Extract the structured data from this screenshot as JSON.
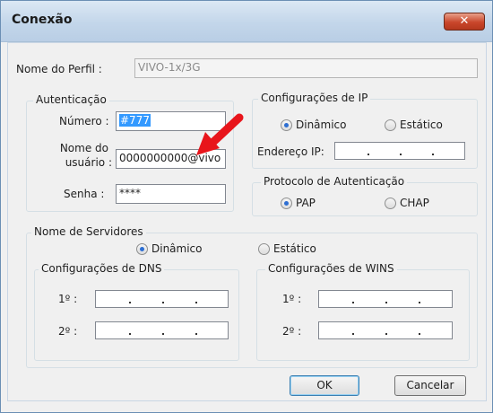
{
  "window": {
    "title": "Conexão",
    "close_label": "✕"
  },
  "profile": {
    "label": "Nome do Perfil :",
    "value": "VIVO-1x/3G"
  },
  "auth": {
    "group_label": "Autenticação",
    "number_label": "Número :",
    "number_value": "#777",
    "user_label_line1": "Nome do",
    "user_label_line2": "usuário :",
    "user_value": "0000000000@vivo",
    "password_label": "Senha :",
    "password_value": "****"
  },
  "ip_config": {
    "group_label": "Configurações de IP",
    "dynamic_label": "Dinâmico",
    "static_label": "Estático",
    "selected": "Dinâmico",
    "address_label": "Endereço IP:"
  },
  "auth_protocol": {
    "group_label": "Protocolo de Autenticação",
    "pap_label": "PAP",
    "chap_label": "CHAP",
    "selected": "PAP"
  },
  "servers": {
    "group_label": "Nome de Servidores",
    "dynamic_label": "Dinâmico",
    "static_label": "Estático",
    "selected": "Dinâmico",
    "dns": {
      "group_label": "Configurações de DNS",
      "first_label": "1º :",
      "second_label": "2º :"
    },
    "wins": {
      "group_label": "Configurações de WINS",
      "first_label": "1º :",
      "second_label": "2º :"
    }
  },
  "buttons": {
    "ok_label": "OK",
    "cancel_label": "Cancelar"
  },
  "annotation": {
    "arrow_color": "#e8151b"
  }
}
